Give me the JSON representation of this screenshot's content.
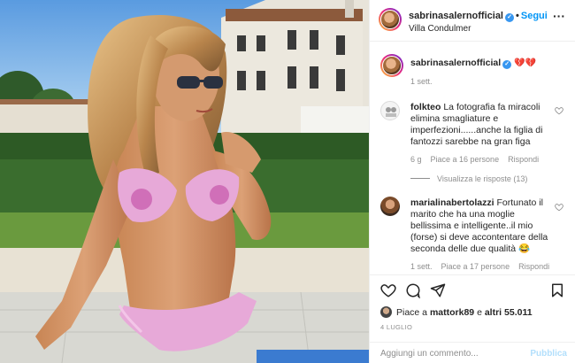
{
  "post": {
    "username": "sabrinasalernofficial",
    "follow_label": "Segui",
    "location": "Villa Condulmer",
    "options_icon": "more-options-icon",
    "photo_description_icon": "post-photo"
  },
  "caption": {
    "username": "sabrinasalernofficial",
    "emoji": "💔💔",
    "time": "1 sett."
  },
  "comments": [
    {
      "username": "folkteo",
      "lines": [
        "La fotografia fa miracoli",
        "elimina smagliature e",
        "imperfezioni......anche la figlia di",
        "fantozzi sarebbe na gran figa"
      ],
      "time": "6 g",
      "likes": "Piace a 16 persone",
      "reply": "Rispondi",
      "view_replies": "Visualizza le risposte (13)"
    },
    {
      "username": "marialinabertolazzi",
      "lines": [
        "Fortunato il",
        "marito che ha una moglie",
        "bellissima e intelligente..il mio",
        "(forse) si deve accontentare della",
        "seconda delle due qualità 😂"
      ],
      "time": "1 sett.",
      "likes": "Piace a 17 persone",
      "reply": "Rispondi"
    }
  ],
  "actions": {
    "likes_prefix": "Piace a",
    "liker": "mattork89",
    "likes_middle": "e",
    "likes_rest": "altri 55.011",
    "date": "4 LUGLIO"
  },
  "add_comment": {
    "placeholder": "Aggiungi un commento...",
    "publish_label": "Pubblica"
  },
  "colors": {
    "link_blue": "#0095f6",
    "verified_blue": "#3897f0",
    "muted_gray": "#8e8e8e",
    "publish_disabled": "#b2dffc",
    "heart_red": "#e0245e"
  }
}
